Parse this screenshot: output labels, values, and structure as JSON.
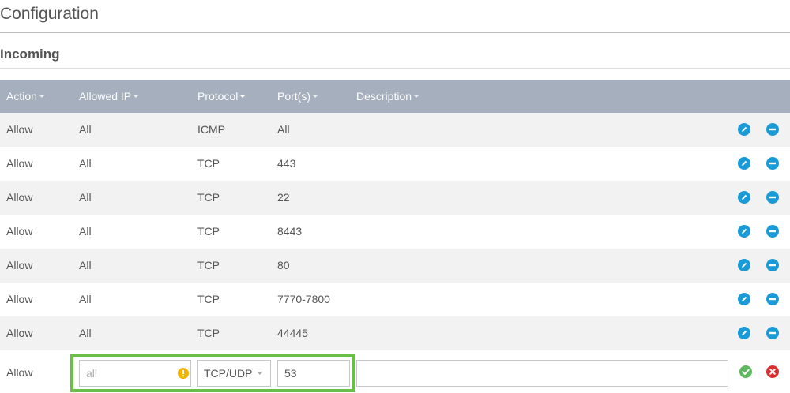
{
  "page": {
    "title": "Configuration",
    "section_title": "Incoming"
  },
  "table": {
    "columns": [
      {
        "label": "Action"
      },
      {
        "label": "Allowed IP"
      },
      {
        "label": "Protocol"
      },
      {
        "label": "Port(s)"
      },
      {
        "label": "Description"
      }
    ],
    "rows": [
      {
        "action": "Allow",
        "ip": "All",
        "protocol": "ICMP",
        "ports": "All",
        "description": ""
      },
      {
        "action": "Allow",
        "ip": "All",
        "protocol": "TCP",
        "ports": "443",
        "description": ""
      },
      {
        "action": "Allow",
        "ip": "All",
        "protocol": "TCP",
        "ports": "22",
        "description": ""
      },
      {
        "action": "Allow",
        "ip": "All",
        "protocol": "TCP",
        "ports": "8443",
        "description": ""
      },
      {
        "action": "Allow",
        "ip": "All",
        "protocol": "TCP",
        "ports": "80",
        "description": ""
      },
      {
        "action": "Allow",
        "ip": "All",
        "protocol": "TCP",
        "ports": "7770-7800",
        "description": ""
      },
      {
        "action": "Allow",
        "ip": "All",
        "protocol": "TCP",
        "ports": "44445",
        "description": ""
      }
    ],
    "row_icons": {
      "edit": "pencil-icon",
      "remove": "minus-circle-icon"
    }
  },
  "new_rule": {
    "action": "Allow",
    "ip_value": "",
    "ip_placeholder": "all",
    "protocol_selected": "TCP/UDP",
    "ports_value": "53",
    "description_value": "",
    "icons": {
      "warning": "warning-icon",
      "confirm": "check-circle-icon",
      "cancel": "x-circle-icon"
    }
  },
  "colors": {
    "header_bg": "#a6afbd",
    "stripe_bg": "#f2f2f2",
    "action_blue": "#1a9ad6",
    "confirm_green": "#5cb85c",
    "cancel_red": "#d9302f",
    "warning_yellow": "#f0b400",
    "highlight_green": "#6abf45"
  }
}
